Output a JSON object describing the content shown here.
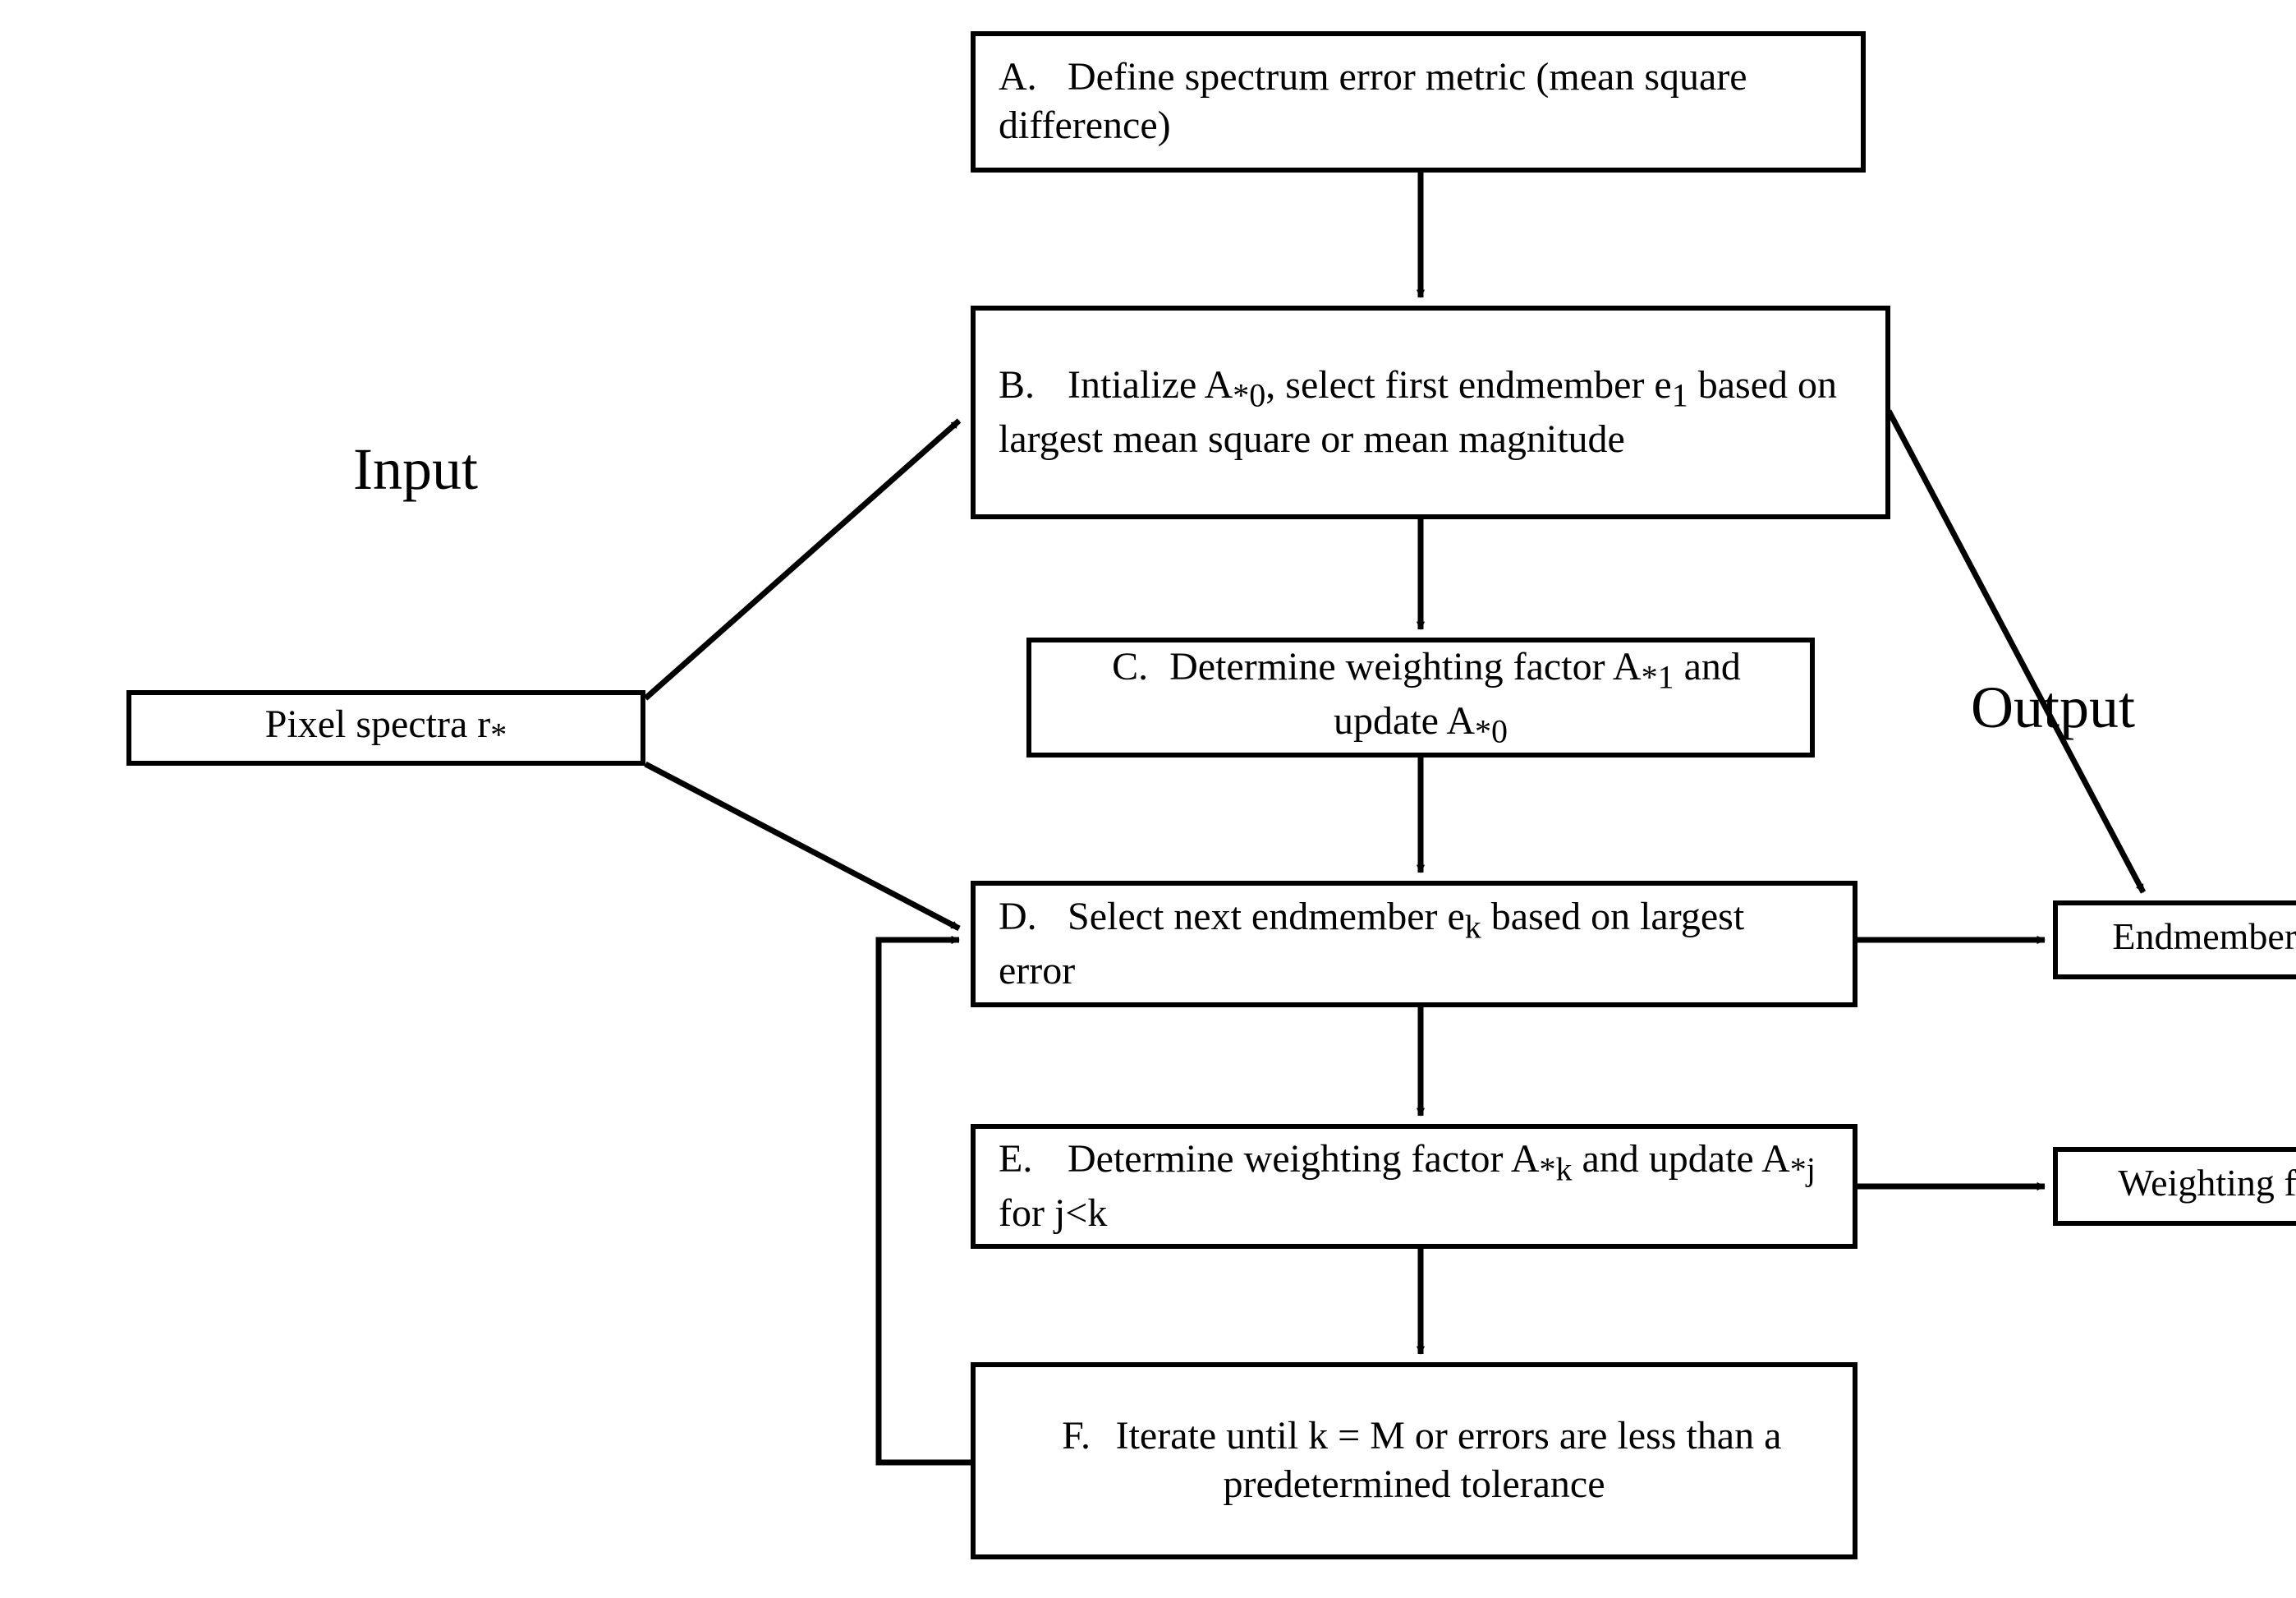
{
  "labels": {
    "input": "Input",
    "output": "Output"
  },
  "nodes": {
    "input_pixel": {
      "text_html": "Pixel spectra r<sub>*</sub>"
    },
    "A": {
      "lead": "A.",
      "text_html": "Define spectrum error metric (mean square difference)"
    },
    "B": {
      "lead": "B.",
      "text_html": "Intialize A<sub>*0</sub>, select first endmember e<sub>1</sub> based on largest mean square or mean magnitude"
    },
    "C": {
      "lead": "C.",
      "text_html": "Determine weighting factor A<sub>*1</sub> and update A<sub>*0</sub>"
    },
    "D": {
      "lead": "D.",
      "text_html": "Select next endmember e<sub>k</sub> based on largest error"
    },
    "E": {
      "lead": "E.",
      "text_html": "Determine weighting factor A<sub>*k</sub> and update A<sub>*j</sub> for j&lt;k"
    },
    "F": {
      "lead": "F.",
      "text_html": "Iterate until k = M or errors are less than a predetermined tolerance"
    },
    "out_endmembers": {
      "text_html": "Endmembers e<sub>j</sub>"
    },
    "out_weights": {
      "text_html": "Weighting factors A<sub>*j</sub>"
    }
  },
  "edges": [
    {
      "id": "A_to_B",
      "from": "A",
      "to": "B",
      "arrow": true
    },
    {
      "id": "B_to_C",
      "from": "B",
      "to": "C",
      "arrow": true
    },
    {
      "id": "C_to_D",
      "from": "C",
      "to": "D",
      "arrow": true
    },
    {
      "id": "D_to_E",
      "from": "D",
      "to": "E",
      "arrow": true
    },
    {
      "id": "E_to_F",
      "from": "E",
      "to": "F",
      "arrow": true
    },
    {
      "id": "input_to_B",
      "from": "input_pixel",
      "to": "B",
      "arrow": true
    },
    {
      "id": "input_to_D",
      "from": "input_pixel",
      "to": "D",
      "arrow": true
    },
    {
      "id": "B_to_endmembers",
      "from": "B",
      "to": "out_endmembers",
      "arrow": true
    },
    {
      "id": "D_to_endmembers",
      "from": "D",
      "to": "out_endmembers",
      "arrow": true
    },
    {
      "id": "E_to_weights",
      "from": "E",
      "to": "out_weights",
      "arrow": true
    },
    {
      "id": "F_loop_to_D",
      "from": "F",
      "to": "D",
      "arrow": true
    }
  ]
}
